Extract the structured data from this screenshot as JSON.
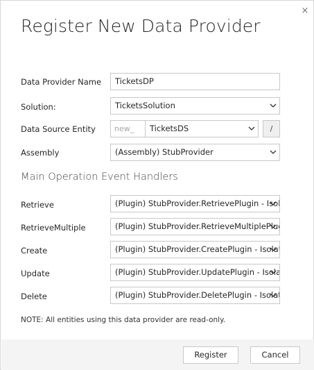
{
  "dialog": {
    "title": "Register New Data Provider",
    "close_glyph": "×"
  },
  "form": {
    "provider_name_label": "Data Provider Name",
    "provider_name_value": "TicketsDP",
    "solution_label": "Solution:",
    "solution_value": "TicketsSolution",
    "data_source_label": "Data Source Entity",
    "data_source_prefix": "new_",
    "data_source_value": "TicketsDS",
    "edit_button_label": "/",
    "assembly_label": "Assembly",
    "assembly_value": "(Assembly) StubProvider"
  },
  "handlers": {
    "section_title": "Main Operation Event Handlers",
    "retrieve_label": "Retrieve",
    "retrieve_value": "(Plugin) StubProvider.RetrievePlugin - Isolation",
    "retrieve_multiple_label": "RetrieveMultiple",
    "retrieve_multiple_value": "(Plugin) StubProvider.RetrieveMultiplePlugin",
    "create_label": "Create",
    "create_value": "(Plugin) StubProvider.CreatePlugin - Isolation",
    "update_label": "Update",
    "update_value": "(Plugin) StubProvider.UpdatePlugin - Isolation",
    "delete_label": "Delete",
    "delete_value": "(Plugin) StubProvider.DeletePlugin - Isolation"
  },
  "note": "NOTE: All entities using this data provider are read-only.",
  "footer": {
    "register_label": "Register",
    "cancel_label": "Cancel"
  },
  "icons": {
    "close": "close-icon",
    "dropdown": "chevron-down-icon"
  }
}
